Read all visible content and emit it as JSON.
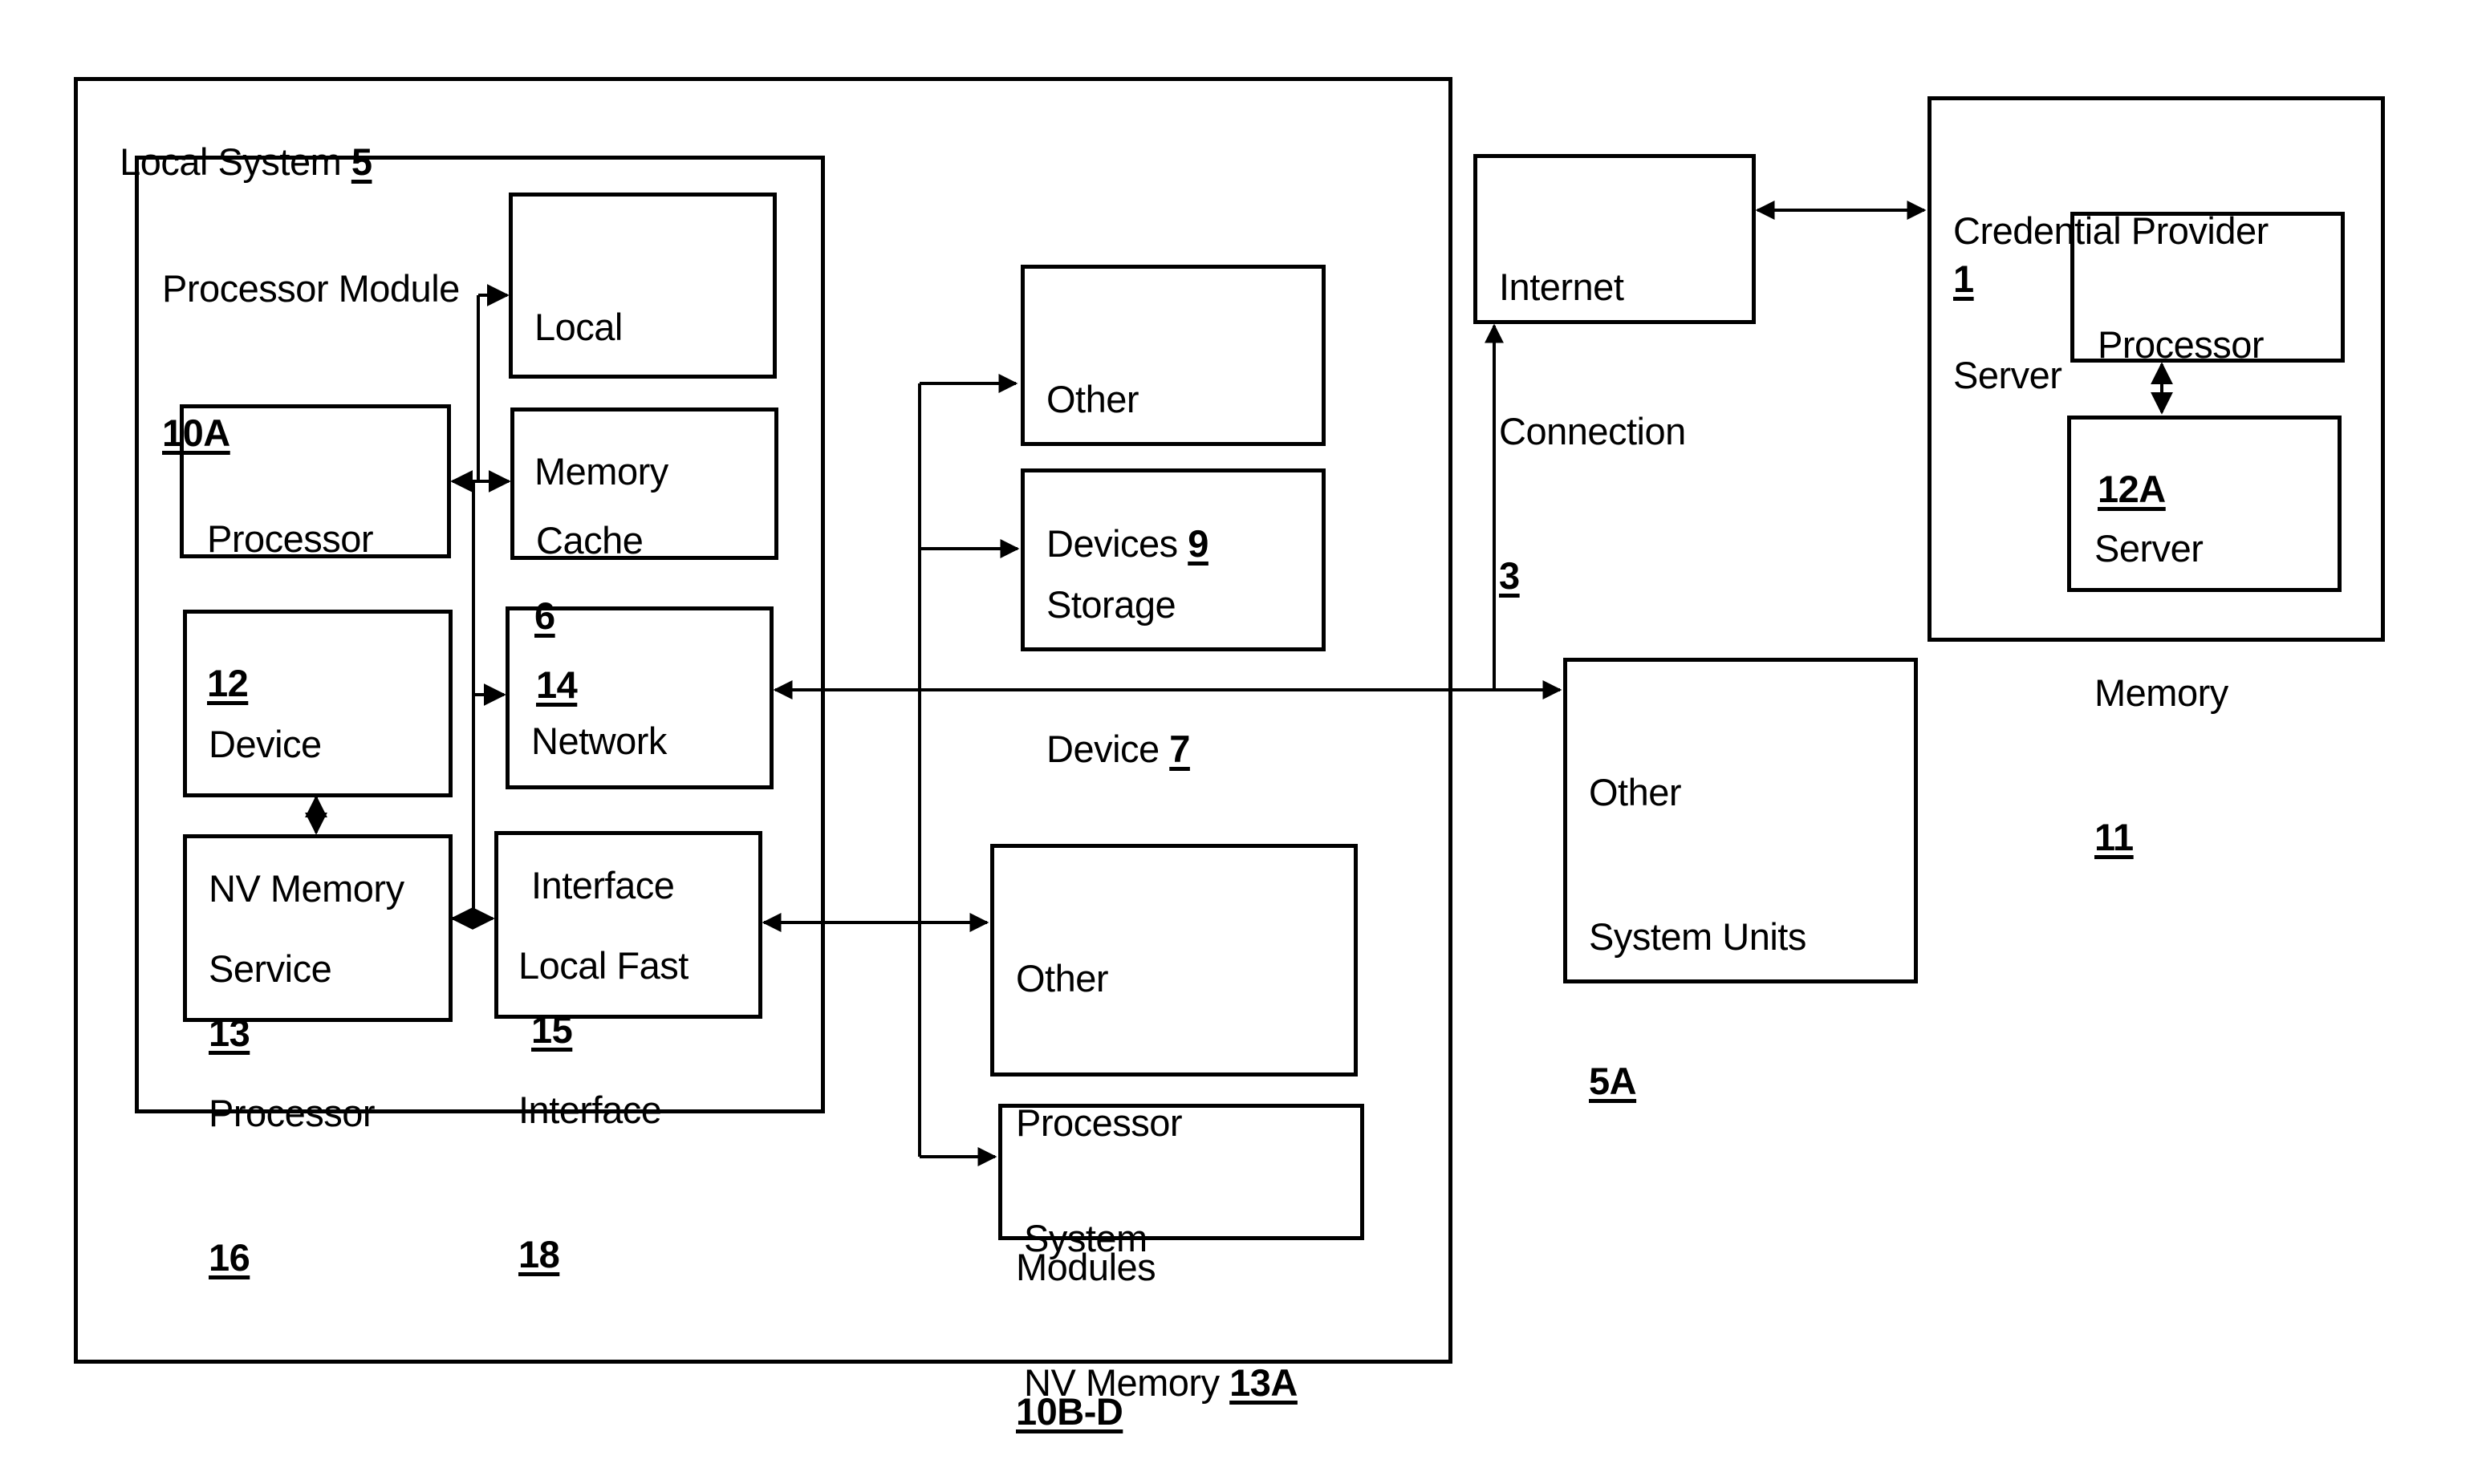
{
  "diagram": {
    "local_system": {
      "name": "Local System",
      "ref": "5"
    },
    "processor_module": {
      "name": "Processor Module",
      "ref": "10A"
    },
    "local_memory": {
      "line1": "Local",
      "line2": "Memory",
      "ref": "6"
    },
    "processor": {
      "line1": "Processor",
      "ref": "12"
    },
    "cache": {
      "line1": "Cache",
      "ref": "14"
    },
    "device_nv_memory": {
      "line1": "Device",
      "line2": "NV Memory",
      "ref": "13"
    },
    "network_interface": {
      "line1": "Network",
      "line2": "Interface",
      "ref": "15"
    },
    "service_processor": {
      "line1": "Service",
      "line2": "Processor",
      "ref": "16"
    },
    "local_fast_interface": {
      "line1": "Local Fast",
      "line2": "Interface",
      "ref": "18"
    },
    "other_devices": {
      "line1": "Other",
      "line2": "Devices",
      "ref": "9"
    },
    "storage_device": {
      "line1": "Storage",
      "line2": "Device",
      "ref": "7"
    },
    "other_processor_modules": {
      "line1": "Other",
      "line2": "Processor",
      "line3": "Modules",
      "ref": "10B-D"
    },
    "system_nv_memory": {
      "line1": "System",
      "line2": "NV Memory",
      "ref": "13A"
    },
    "internet_connection": {
      "line1": "Internet",
      "line2": "Connection",
      "ref": "3"
    },
    "credential_provider_server": {
      "line1": "Credential Provider",
      "line2": "Server",
      "ref": "1"
    },
    "processor_12a": {
      "line1": "Processor",
      "ref": "12A"
    },
    "server_memory": {
      "line1": "Server",
      "line2": "Memory",
      "ref": "11"
    },
    "other_system_units": {
      "line1": "Other",
      "line2": "System Units",
      "ref": "5A"
    }
  },
  "colors": {
    "ink": "#000000",
    "paper": "#ffffff"
  }
}
